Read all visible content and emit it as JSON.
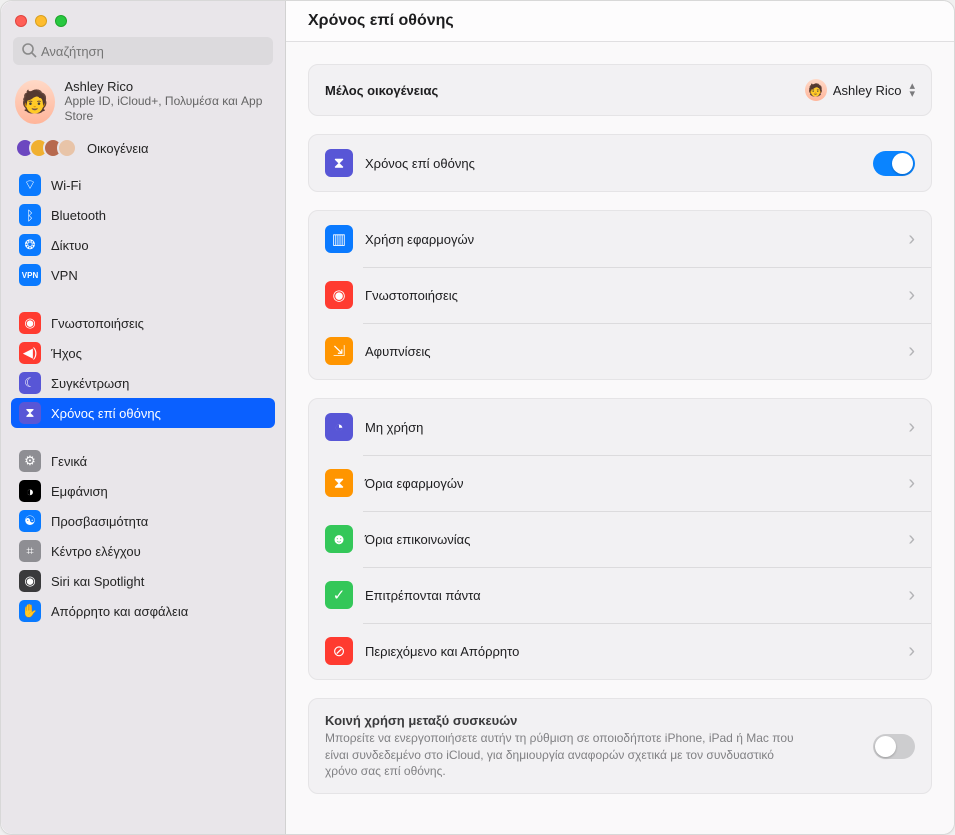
{
  "header": {
    "title": "Χρόνος επί οθόνης"
  },
  "search": {
    "placeholder": "Αναζήτηση"
  },
  "account": {
    "name": "Ashley Rico",
    "subtitle": "Apple ID, iCloud+, Πολυμέσα και App Store"
  },
  "family": {
    "label": "Οικογένεια"
  },
  "sidebar_groups": [
    [
      {
        "label": "Wi-Fi",
        "color": "#0a7aff",
        "icon": "wifi"
      },
      {
        "label": "Bluetooth",
        "color": "#0a7aff",
        "icon": "bluetooth"
      },
      {
        "label": "Δίκτυο",
        "color": "#0a7aff",
        "icon": "globe"
      },
      {
        "label": "VPN",
        "color": "#0a7aff",
        "icon": "vpn"
      }
    ],
    [
      {
        "label": "Γνωστοποιήσεις",
        "color": "#ff3b30",
        "icon": "bell"
      },
      {
        "label": "Ήχος",
        "color": "#ff3b30",
        "icon": "sound"
      },
      {
        "label": "Συγκέντρωση",
        "color": "#5856d6",
        "icon": "moon"
      },
      {
        "label": "Χρόνος επί οθόνης",
        "color": "#5856d6",
        "icon": "hourglass",
        "selected": true
      }
    ],
    [
      {
        "label": "Γενικά",
        "color": "#8e8e93",
        "icon": "gear"
      },
      {
        "label": "Εμφάνιση",
        "color": "#000000",
        "icon": "appearance"
      },
      {
        "label": "Προσβασιμότητα",
        "color": "#0a7aff",
        "icon": "accessibility"
      },
      {
        "label": "Κέντρο ελέγχου",
        "color": "#8e8e93",
        "icon": "control"
      },
      {
        "label": "Siri και Spotlight",
        "color": "#3a3a3c",
        "icon": "siri"
      },
      {
        "label": "Απόρρητο και ασφάλεια",
        "color": "#0a7aff",
        "icon": "hand"
      }
    ]
  ],
  "main": {
    "family_member": {
      "caption": "Μέλος οικογένειας",
      "value": "Ashley Rico"
    },
    "screen_time_toggle": {
      "label": "Χρόνος επί οθόνης",
      "on": true,
      "color": "#5856d6",
      "icon": "hourglass"
    },
    "group_usage": [
      {
        "label": "Χρήση εφαρμογών",
        "color": "#0a7aff",
        "icon": "chart"
      },
      {
        "label": "Γνωστοποιήσεις",
        "color": "#ff3b30",
        "icon": "bell"
      },
      {
        "label": "Αφυπνίσεις",
        "color": "#ff9500",
        "icon": "pickup"
      }
    ],
    "group_limits": [
      {
        "label": "Μη χρήση",
        "color": "#5856d6",
        "icon": "downtime"
      },
      {
        "label": "Όρια εφαρμογών",
        "color": "#ff9500",
        "icon": "hourglass"
      },
      {
        "label": "Όρια επικοινωνίας",
        "color": "#34c759",
        "icon": "person"
      },
      {
        "label": "Επιτρέπονται πάντα",
        "color": "#34c759",
        "icon": "check"
      },
      {
        "label": "Περιεχόμενο και Απόρρητο",
        "color": "#ff3b30",
        "icon": "nosign"
      }
    ],
    "share": {
      "title": "Κοινή χρήση μεταξύ συσκευών",
      "desc": "Μπορείτε να ενεργοποιήσετε αυτήν τη ρύθμιση σε οποιοδήποτε iPhone, iPad ή Mac που είναι συνδεδεμένο στο iCloud, για δημιουργία αναφορών σχετικά με τον συνδυαστικό χρόνο σας επί οθόνης.",
      "on": false
    }
  },
  "icons": {
    "wifi": "⌔",
    "bluetooth": "ᛒ",
    "globe": "❂",
    "vpn": "VPN",
    "bell": "◉",
    "sound": "◀)",
    "moon": "☾",
    "hourglass": "⧗",
    "gear": "⚙",
    "appearance": "◑",
    "accessibility": "☯",
    "control": "⌗",
    "siri": "◉",
    "hand": "✋",
    "chart": "▥",
    "pickup": "⇲",
    "downtime": "◔",
    "person": "☻",
    "check": "✓",
    "nosign": "⊘"
  }
}
